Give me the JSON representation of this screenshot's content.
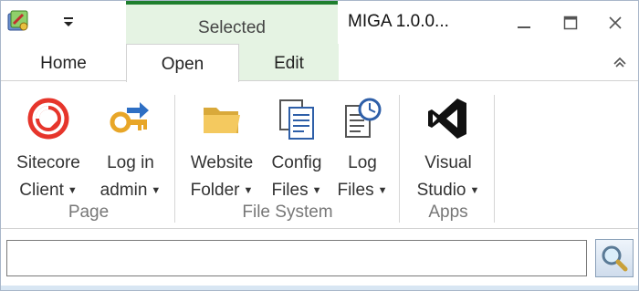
{
  "titlebar": {
    "context_tab": "Selected",
    "title": "MIGA 1.0.0..."
  },
  "tabs": [
    {
      "label": "Home"
    },
    {
      "label": "Open"
    },
    {
      "label": "Edit"
    }
  ],
  "ribbon": {
    "groups": [
      {
        "label": "Page",
        "buttons": [
          {
            "line1": "Sitecore",
            "line2": "Client",
            "icon": "sitecore-logo-icon"
          },
          {
            "line1": "Log in",
            "line2": "admin",
            "icon": "key-icon"
          }
        ]
      },
      {
        "label": "File System",
        "buttons": [
          {
            "line1": "Website",
            "line2": "Folder",
            "icon": "folder-icon"
          },
          {
            "line1": "Config",
            "line2": "Files",
            "icon": "documents-icon"
          },
          {
            "line1": "Log",
            "line2": "Files",
            "icon": "log-clock-icon"
          }
        ]
      },
      {
        "label": "Apps",
        "buttons": [
          {
            "line1": "Visual",
            "line2": "Studio",
            "icon": "visual-studio-icon"
          }
        ]
      }
    ]
  },
  "search": {
    "value": "",
    "placeholder": ""
  },
  "colors": {
    "context_accent": "#1e7f2e",
    "context_bg": "#e5f3e3",
    "border": "#d2d2d2"
  }
}
